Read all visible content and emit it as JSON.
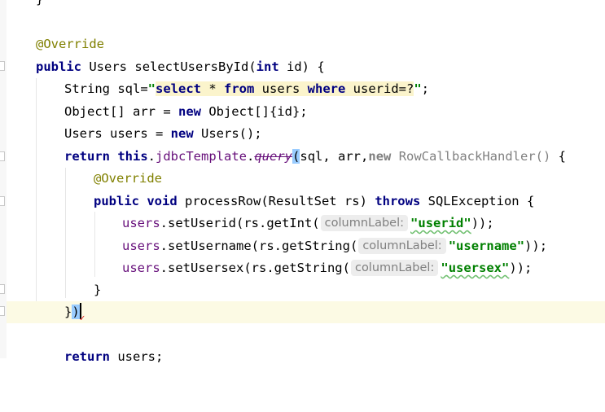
{
  "editor": {
    "lines": {
      "top_brace": "}",
      "override1": "@Override",
      "sig": {
        "public": "public",
        "type": "Users",
        "name": "selectUsersById(",
        "int": "int",
        "param": "id) {"
      },
      "sql": {
        "type": "String sql=",
        "q1": "\"",
        "select": "select",
        "star_from_pre": " * ",
        "from": "from",
        "users": " users ",
        "where": "where",
        "cond": " userid=?",
        "q2": "\"",
        "semi": ";"
      },
      "arr": {
        "pre": "Object[] arr = ",
        "new": "new",
        "post": " Object[]{id};"
      },
      "usersdecl": {
        "pre": "Users users = ",
        "new": "new",
        "post": " Users();"
      },
      "ret": {
        "return": "return",
        "this": "this",
        "dot": ".",
        "field": "jdbcTemplate",
        "dot2": ".",
        "query": "query",
        "paren": "(",
        "args": "sql, arr,",
        "new": "new",
        "handler": " RowCallbackHandler()",
        "brace": " {"
      },
      "override2": "@Override",
      "process": {
        "public": "public",
        "void": "void",
        "name": " processRow(ResultSet rs) ",
        "throws": "throws",
        "ex": " SQLException {"
      },
      "setid": {
        "var": "users",
        "call": ".setUserid(rs.getInt(",
        "hint": "columnLabel:",
        "str": "\"userid\"",
        "end": "));"
      },
      "setname": {
        "var": "users",
        "call": ".setUsername(rs.getString(",
        "hint": "columnLabel:",
        "str": "\"username\"",
        "end": "));"
      },
      "setsex": {
        "var": "users",
        "call": ".setUsersex(rs.getString(",
        "hint": "columnLabel:",
        "str": "\"usersex\"",
        "end": "));"
      },
      "close_inner": "}",
      "close_call": {
        "brace": "}",
        "paren": ")"
      },
      "ret2": {
        "return": "return",
        "post": " users;"
      }
    }
  }
}
